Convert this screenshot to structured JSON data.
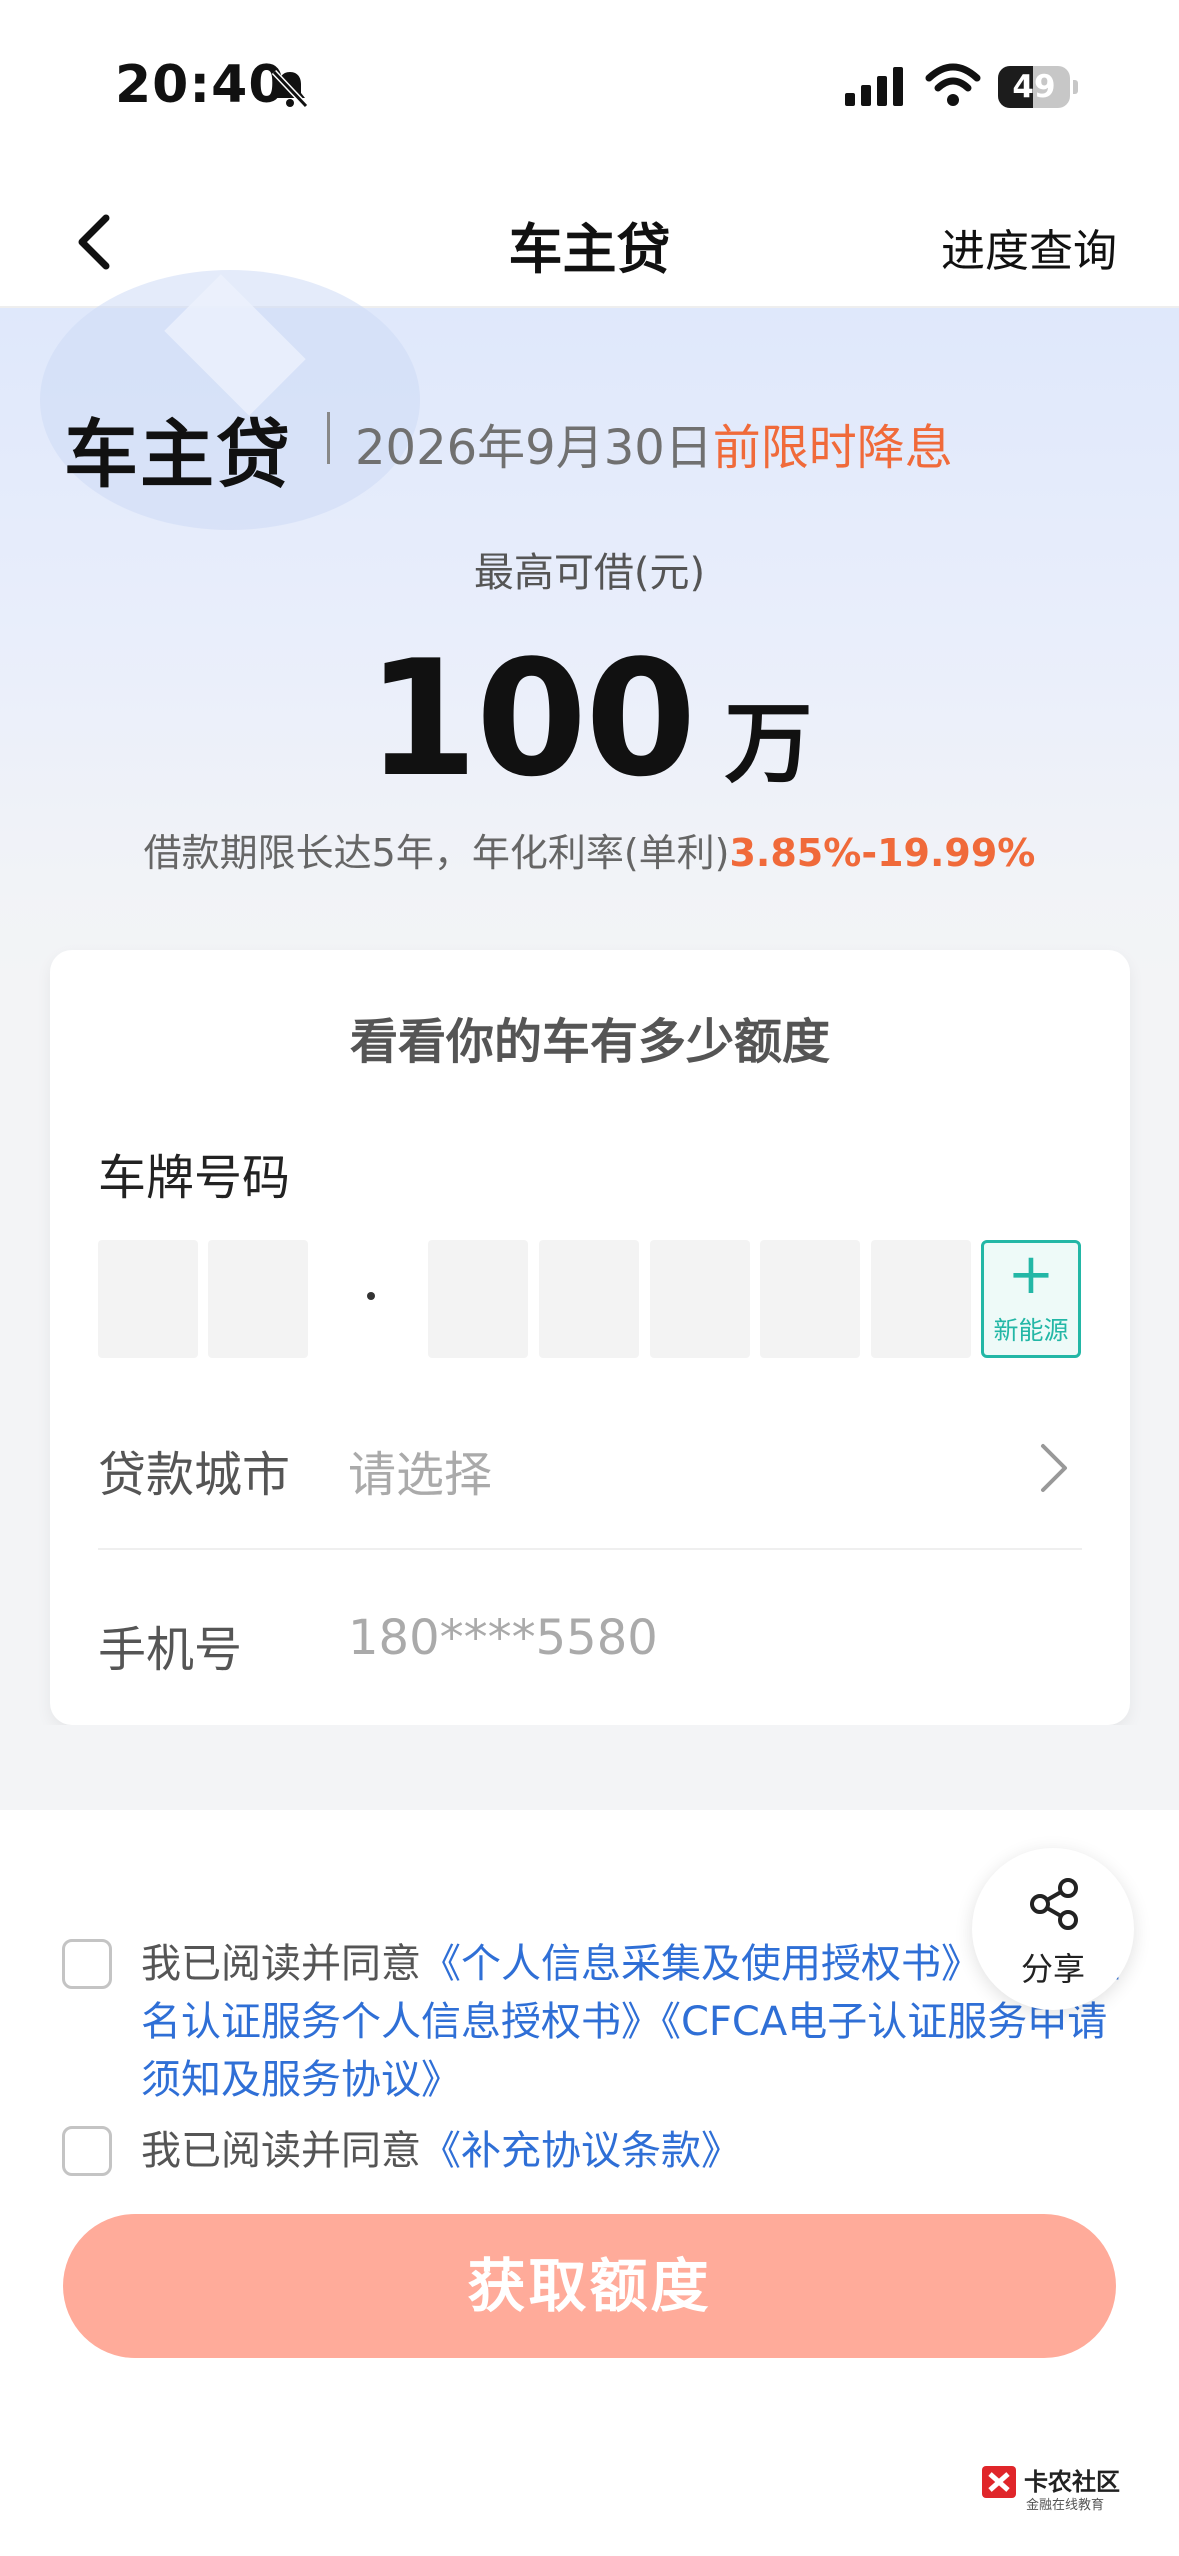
{
  "status_bar": {
    "time": "20:40",
    "battery_level": "49",
    "battery_fraction": 0.49
  },
  "nav": {
    "title": "车主贷",
    "right_link": "进度查询"
  },
  "hero": {
    "brand": "车主贷",
    "promo_date": "2026年9月30日",
    "promo_tag": "前限时降息",
    "max_label": "最高可借(元)",
    "amount": "100",
    "amount_unit": "万",
    "term_text": "借款期限长达5年，年化利率(单利)",
    "rate_range": "3.85%-19.99%"
  },
  "form": {
    "title": "看看你的车有多少额度",
    "plate_label": "车牌号码",
    "plate_dot": "·",
    "new_energy_plus": "+",
    "new_energy_label": "新能源",
    "city_label": "贷款城市",
    "city_placeholder": "请选择",
    "phone_label": "手机号",
    "phone_value": "180****5580"
  },
  "agreements": {
    "prefix": "我已阅读并同意",
    "line1_links": "《个人信息采集及使用授权书》《电子签名认证服务个人信息授权书》《CFCA电子认证服务申请须知及服务协议》",
    "line2_link": "《补充协议条款》"
  },
  "share": {
    "label": "分享"
  },
  "submit": {
    "label": "获取额度"
  },
  "watermark": {
    "title": "卡农社区",
    "subtitle": "金融在线教育"
  },
  "colors": {
    "accent_orange": "#f06a3a",
    "link_blue": "#2f6fd6",
    "button_bg": "#ffab9a",
    "teal": "#23b7a6"
  }
}
